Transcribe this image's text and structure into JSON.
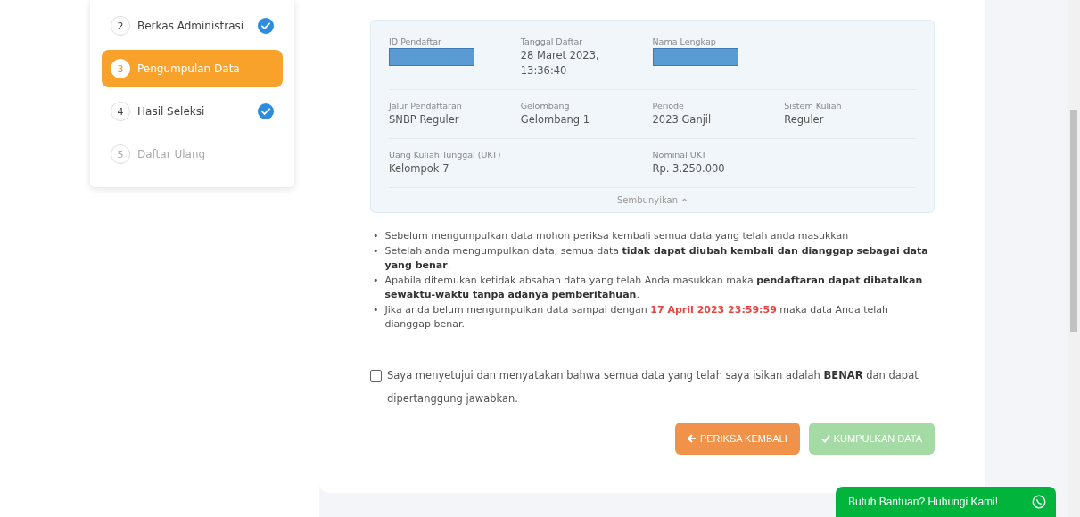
{
  "steps": [
    {
      "number": "2",
      "label": "Berkas Administrasi",
      "selected": false,
      "done": true,
      "disabled": false
    },
    {
      "number": "3",
      "label": "Pengumpulan Data",
      "selected": true,
      "done": false,
      "disabled": false
    },
    {
      "number": "4",
      "label": "Hasil Seleksi",
      "selected": false,
      "done": true,
      "disabled": false
    },
    {
      "number": "5",
      "label": "Daftar Ulang",
      "selected": false,
      "done": false,
      "disabled": true
    }
  ],
  "info_rows": [
    [
      {
        "label": "ID Pendaftar",
        "kind": "redacted"
      },
      {
        "label": "Tanggal Daftar",
        "kind": "text",
        "value": "28 Maret 2023, 13:36:40"
      },
      {
        "label": "Nama Lengkap",
        "kind": "redacted"
      }
    ],
    [
      {
        "label": "Jalur Pendaftaran",
        "kind": "text",
        "value": "SNBP Reguler"
      },
      {
        "label": "Gelombang",
        "kind": "text",
        "value": "Gelombang 1"
      },
      {
        "label": "Periode",
        "kind": "text",
        "value": "2023 Ganjil"
      },
      {
        "label": "Sistem Kuliah",
        "kind": "text",
        "value": "Reguler"
      }
    ],
    [
      {
        "label": "Uang Kuliah Tunggal (UKT)",
        "kind": "text",
        "value": "Kelompok 7"
      },
      {
        "label": "Nominal UKT",
        "kind": "text",
        "value": "Rp. 3.250.000"
      }
    ]
  ],
  "toggle_label": "Sembunyikan",
  "notes": [
    {
      "marker": "•",
      "text": "Sebelum mengumpulkan data mohon periksa kembali semua data yang telah anda masukkan"
    },
    {
      "marker": "•",
      "text": "Setelah anda mengumpulkan data, semua data **tidak dapat diubah kembali dan dianggap sebagai data yang benar**."
    },
    {
      "marker": "•",
      "text": "Apabila ditemukan ketidak absahan data yang telah Anda masukkan maka **pendaftaran dapat dibatalkan sewaktu-waktu tanpa adanya pemberitahuan**."
    },
    {
      "marker": "•",
      "text": "Jika anda belum mengumpulkan data sampai dengan *17 April 2023 23:59:59* maka data Anda telah dianggap benar."
    }
  ],
  "agreement": {
    "text": "Saya menyetujui dan menyatakan bahwa semua data yang telah saya isikan adalah **BENAR** dan dapat dipertanggung jawabkan.",
    "checked": false
  },
  "buttons": [
    {
      "label": "PERIKSA KEMBALI",
      "kind": "back",
      "disabled": false
    },
    {
      "label": "KUMPULKAN DATA",
      "kind": "submit",
      "disabled": true
    }
  ],
  "help_button": {
    "label": "Butuh Bantuan? Hubungi Kami!"
  }
}
